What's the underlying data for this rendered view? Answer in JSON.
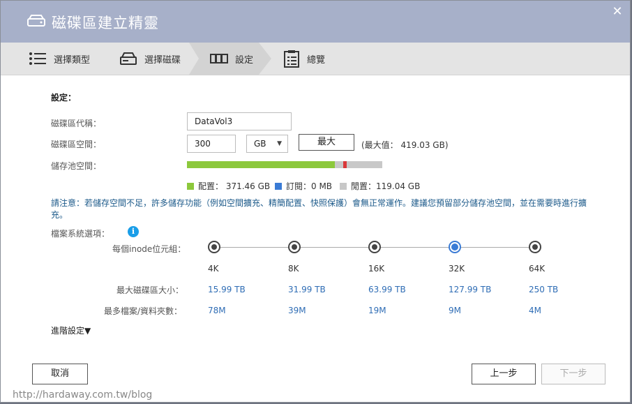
{
  "window": {
    "title": "磁碟區建立精靈",
    "close_glyph": "✕"
  },
  "steps": [
    {
      "label": "選擇類型",
      "icon": "list-icon"
    },
    {
      "label": "選擇磁碟",
      "icon": "disk-icon"
    },
    {
      "label": "設定",
      "icon": "settings-icon",
      "active": true
    },
    {
      "label": "總覽",
      "icon": "clipboard-icon"
    }
  ],
  "settings": {
    "section_title": "設定：",
    "alias_label": "磁碟區代稱：",
    "alias_value": "DataVol3",
    "capacity_label": "磁碟區空間：",
    "capacity_value": "300",
    "capacity_unit": "GB",
    "max_button": "最大",
    "max_value_text": "(最大值： 419.03 GB)",
    "pool_label": "儲存池空間："
  },
  "pool": {
    "allocated_fraction": 0.757,
    "reserved_fraction": 0.0,
    "legend_allocated": "配置： 371.46 GB",
    "legend_reserved": "訂閱：0 MB",
    "legend_free": "閒置：119.04 GB",
    "colors": {
      "allocated": "#8cc83c",
      "reserved": "#3a7bd5",
      "free": "#c8c8c8",
      "marker": "#d9383a"
    }
  },
  "notice": "請注意：若儲存空間不足，許多儲存功能（例如空間擴充、精簡配置、快照保護）會無正常運作。建議您預留部分儲存池空間，並在需要時進行擴充。",
  "filesystem": {
    "label": "檔案系統選項：",
    "inode_label": "每個inode位元組：",
    "maxsize_label": "最大磁碟區大小：",
    "maxfiles_label": "最多檔案/資料夾數：",
    "options": [
      {
        "inode": "4K",
        "max_size": "15.99 TB",
        "max_files": "78M",
        "selected": false
      },
      {
        "inode": "8K",
        "max_size": "31.99 TB",
        "max_files": "39M",
        "selected": false
      },
      {
        "inode": "16K",
        "max_size": "63.99 TB",
        "max_files": "19M",
        "selected": false
      },
      {
        "inode": "32K",
        "max_size": "127.99 TB",
        "max_files": "9M",
        "selected": true
      },
      {
        "inode": "64K",
        "max_size": "250 TB",
        "max_files": "4M",
        "selected": false
      }
    ]
  },
  "advanced": "進階設定▼",
  "footer": {
    "cancel": "取消",
    "back": "上一步",
    "next": "下一步"
  },
  "watermark": "http://hardaway.com.tw/blog"
}
